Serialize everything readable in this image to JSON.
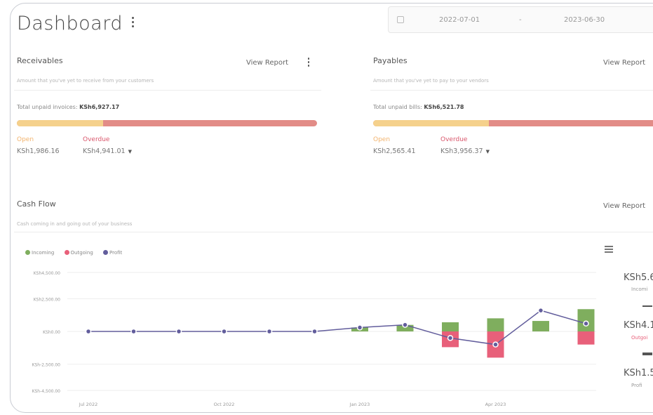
{
  "page": {
    "title": "Dashboard"
  },
  "date_range": {
    "from": "2022-07-01",
    "separator": "-",
    "to": "2023-06-30"
  },
  "receivables": {
    "title": "Receivables",
    "view_report": "View Report",
    "subtitle": "Amount that you've yet to receive from your customers",
    "unpaid_label": "Total unpaid invoices",
    "unpaid_value": "KSh6,927.17",
    "open_label": "Open",
    "open_value": "KSh1,986.16",
    "overdue_label": "Overdue",
    "overdue_value": "KSh4,941.01",
    "open_fraction": 0.287
  },
  "payables": {
    "title": "Payables",
    "view_report": "View Report",
    "subtitle": "Amount that you've yet to pay to your vendors",
    "unpaid_label": "Total unpaid bills",
    "unpaid_value": "KSh6,521.78",
    "open_label": "Open",
    "open_value": "KSh2,565.41",
    "overdue_label": "Overdue",
    "overdue_value": "KSh3,956.37",
    "open_fraction": 0.393
  },
  "cash_flow": {
    "title": "Cash Flow",
    "view_report": "View Report",
    "subtitle": "Cash coming in and going out of your business",
    "summary": {
      "incoming_value": "KSh5.6",
      "incoming_label": "Incomi",
      "outgoing_value": "KSh4.1",
      "outgoing_label": "Outgoi",
      "profit_value": "KSh1.5",
      "profit_label": "Profi"
    }
  },
  "colors": {
    "incoming": "#7fae5e",
    "outgoing": "#e8607a",
    "profit": "#625d9c",
    "open": "#f5d18c",
    "overdue": "#e28c87"
  },
  "icons": {
    "calendar": "calendar-icon",
    "menu": "hamburger-menu-icon",
    "kebab": "kebab-menu-icon"
  },
  "chart_data": {
    "type": "bar",
    "legend": [
      "Incoming",
      "Outgoing",
      "Profit"
    ],
    "legend_placement": "top-left",
    "y_ticks": [
      "KSh4,500.00",
      "KSh2,500.00",
      "KSh0.00",
      "KSh-2,500.00",
      "KSh-4,500.00"
    ],
    "y_tick_values": [
      4500,
      2500,
      0,
      -2500,
      -4500
    ],
    "ylim": [
      -4500,
      4500
    ],
    "x_ticks": [
      "Jul 2022",
      "Oct 2022",
      "Jan 2023",
      "Apr 2023"
    ],
    "x_tick_index": [
      0,
      3,
      6,
      9
    ],
    "categories": [
      "Jul 2022",
      "Aug 2022",
      "Sep 2022",
      "Oct 2022",
      "Nov 2022",
      "Dec 2022",
      "Jan 2023",
      "Feb 2023",
      "Mar 2023",
      "Apr 2023",
      "May 2023",
      "Jun 2023"
    ],
    "series": [
      {
        "name": "Incoming",
        "values": [
          0,
          0,
          0,
          0,
          0,
          0,
          0,
          0,
          700,
          1000,
          800,
          1700
        ]
      },
      {
        "name": "Outgoing",
        "values": [
          0,
          0,
          0,
          0,
          0,
          0,
          0,
          0,
          -1200,
          -2000,
          0,
          -1000
        ]
      },
      {
        "name": "Profit",
        "values": [
          0,
          0,
          0,
          0,
          0,
          0,
          0,
          0,
          -500,
          -1000,
          1600,
          600
        ]
      }
    ],
    "incoming_pair": {
      "jan": 300,
      "feb": 500
    },
    "grid": true
  }
}
